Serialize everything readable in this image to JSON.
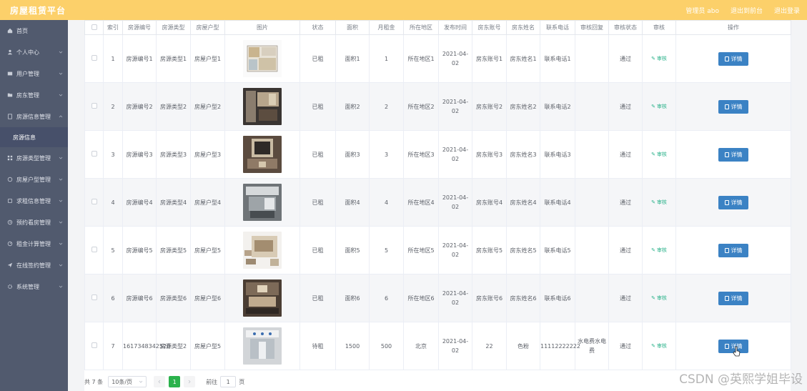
{
  "header": {
    "title": "房屋租赁平台",
    "links": [
      "管理员 abo",
      "退出到前台",
      "退出登录"
    ]
  },
  "sidebar": {
    "items": [
      {
        "label": "首页",
        "icon": "home-icon",
        "has_children": false
      },
      {
        "label": "个人中心",
        "icon": "user-icon",
        "has_children": true
      },
      {
        "label": "用户管理",
        "icon": "list-icon",
        "has_children": true
      },
      {
        "label": "房东管理",
        "icon": "folder-icon",
        "has_children": true
      },
      {
        "label": "房源信息管理",
        "icon": "document-icon",
        "has_children": true,
        "expanded": true,
        "children": [
          "房源信息"
        ]
      },
      {
        "label": "房源类型管理",
        "icon": "grid-icon",
        "has_children": true
      },
      {
        "label": "房屋户型管理",
        "icon": "box-icon",
        "has_children": true
      },
      {
        "label": "求租信息管理",
        "icon": "puzzle-icon",
        "has_children": true
      },
      {
        "label": "预约看房管理",
        "icon": "clock-icon",
        "has_children": true
      },
      {
        "label": "租金计算管理",
        "icon": "timer-icon",
        "has_children": true
      },
      {
        "label": "在线签约管理",
        "icon": "send-icon",
        "has_children": true
      },
      {
        "label": "系统管理",
        "icon": "gear-icon",
        "has_children": true
      }
    ]
  },
  "table": {
    "columns": [
      "",
      "索引",
      "房源编号",
      "房源类型",
      "房屋户型",
      "图片",
      "状态",
      "面积",
      "月租金",
      "所在地区",
      "发布时间",
      "房东账号",
      "房东姓名",
      "联系电话",
      "审核回复",
      "审核状态",
      "审核",
      "操作"
    ],
    "audit_label": "审核",
    "detail_label": "详情",
    "rows": [
      {
        "index": "1",
        "code": "房源编号1",
        "type": "房源类型1",
        "layout": "房屋户型1",
        "status": "已租",
        "area": "面积1",
        "rent": "1",
        "region": "所在地区1",
        "date": "2021-04-02",
        "account": "房东账号1",
        "name": "房东姓名1",
        "phone": "联系电话1",
        "reply": "",
        "audit_status": "通过"
      },
      {
        "index": "2",
        "code": "房源编号2",
        "type": "房源类型2",
        "layout": "房屋户型2",
        "status": "已租",
        "area": "面积2",
        "rent": "2",
        "region": "所在地区2",
        "date": "2021-04-02",
        "account": "房东账号2",
        "name": "房东姓名2",
        "phone": "联系电话2",
        "reply": "",
        "audit_status": "通过"
      },
      {
        "index": "3",
        "code": "房源编号3",
        "type": "房源类型3",
        "layout": "房屋户型3",
        "status": "已租",
        "area": "面积3",
        "rent": "3",
        "region": "所在地区3",
        "date": "2021-04-02",
        "account": "房东账号3",
        "name": "房东姓名3",
        "phone": "联系电话3",
        "reply": "",
        "audit_status": "通过"
      },
      {
        "index": "4",
        "code": "房源编号4",
        "type": "房源类型4",
        "layout": "房屋户型4",
        "status": "已租",
        "area": "面积4",
        "rent": "4",
        "region": "所在地区4",
        "date": "2021-04-02",
        "account": "房东账号4",
        "name": "房东姓名4",
        "phone": "联系电话4",
        "reply": "",
        "audit_status": "通过"
      },
      {
        "index": "5",
        "code": "房源编号5",
        "type": "房源类型5",
        "layout": "房屋户型5",
        "status": "已租",
        "area": "面积5",
        "rent": "5",
        "region": "所在地区5",
        "date": "2021-04-02",
        "account": "房东账号5",
        "name": "房东姓名5",
        "phone": "联系电话5",
        "reply": "",
        "audit_status": "通过"
      },
      {
        "index": "6",
        "code": "房源编号6",
        "type": "房源类型6",
        "layout": "房屋户型6",
        "status": "已租",
        "area": "面积6",
        "rent": "6",
        "region": "所在地区6",
        "date": "2021-04-02",
        "account": "房东账号6",
        "name": "房东姓名6",
        "phone": "联系电话6",
        "reply": "",
        "audit_status": "通过"
      },
      {
        "index": "7",
        "code": "1617348342520",
        "type": "房源类型2",
        "layout": "房屋户型5",
        "status": "待租",
        "area": "1500",
        "rent": "500",
        "region": "北京",
        "date": "2021-04-02",
        "account": "22",
        "name": "色粉",
        "phone": "11112222222",
        "reply": "水电费水电费",
        "audit_status": "通过"
      }
    ]
  },
  "pagination": {
    "total": "共 7 条",
    "page_size": "10条/页",
    "current_page": "1",
    "goto_label": "前往",
    "goto_value": "1",
    "page_suffix": "页"
  },
  "watermark": "CSDN @英熙学姐毕设",
  "colors": {
    "header": "#fcd06a",
    "sidebar": "#515a6e",
    "primary_button": "#3b82c4",
    "active_page": "#2bb24c",
    "audit_link": "#2ab28a"
  }
}
